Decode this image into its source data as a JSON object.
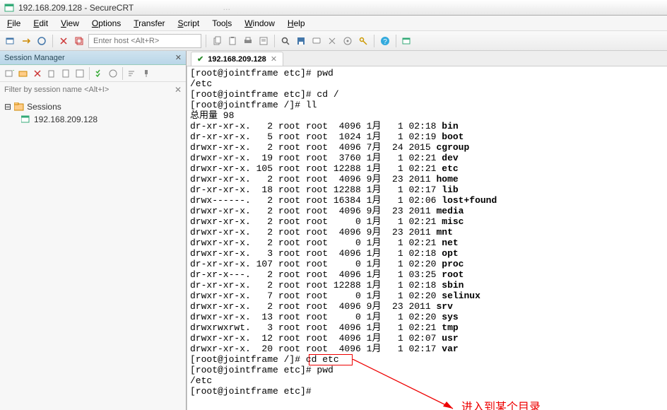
{
  "window": {
    "title": "192.168.209.128 - SecureCRT",
    "blurred_tab": "…"
  },
  "menu": [
    "File",
    "Edit",
    "View",
    "Options",
    "Transfer",
    "Script",
    "Tools",
    "Window",
    "Help"
  ],
  "toolbar": {
    "host_placeholder": "Enter host <Alt+R>"
  },
  "session_manager": {
    "title": "Session Manager",
    "filter_placeholder": "Filter by session name <Alt+I>",
    "root": "Sessions",
    "node": "192.168.209.128"
  },
  "tab": {
    "label": "192.168.209.128"
  },
  "terminal": {
    "lines": [
      {
        "t": "[root@jointframe etc]# pwd"
      },
      {
        "t": "/etc"
      },
      {
        "t": "[root@jointframe etc]# cd /"
      },
      {
        "t": "[root@jointframe /]# ll"
      },
      {
        "t": "总用量 98"
      },
      {
        "t": "dr-xr-xr-x.   2 root root  4096 1月   1 02:18 ",
        "b": "bin"
      },
      {
        "t": "dr-xr-xr-x.   5 root root  1024 1月   1 02:19 ",
        "b": "boot"
      },
      {
        "t": "drwxr-xr-x.   2 root root  4096 7月  24 2015 ",
        "b": "cgroup"
      },
      {
        "t": "drwxr-xr-x.  19 root root  3760 1月   1 02:21 ",
        "b": "dev"
      },
      {
        "t": "drwxr-xr-x. 105 root root 12288 1月   1 02:21 ",
        "b": "etc"
      },
      {
        "t": "drwxr-xr-x.   2 root root  4096 9月  23 2011 ",
        "b": "home"
      },
      {
        "t": "dr-xr-xr-x.  18 root root 12288 1月   1 02:17 ",
        "b": "lib"
      },
      {
        "t": "drwx------.   2 root root 16384 1月   1 02:06 ",
        "b": "lost+found"
      },
      {
        "t": "drwxr-xr-x.   2 root root  4096 9月  23 2011 ",
        "b": "media"
      },
      {
        "t": "drwxr-xr-x.   2 root root     0 1月   1 02:21 ",
        "b": "misc"
      },
      {
        "t": "drwxr-xr-x.   2 root root  4096 9月  23 2011 ",
        "b": "mnt"
      },
      {
        "t": "drwxr-xr-x.   2 root root     0 1月   1 02:21 ",
        "b": "net"
      },
      {
        "t": "drwxr-xr-x.   3 root root  4096 1月   1 02:18 ",
        "b": "opt"
      },
      {
        "t": "dr-xr-xr-x. 107 root root     0 1月   1 02:20 ",
        "b": "proc"
      },
      {
        "t": "dr-xr-x---.   2 root root  4096 1月   1 03:25 ",
        "b": "root"
      },
      {
        "t": "dr-xr-xr-x.   2 root root 12288 1月   1 02:18 ",
        "b": "sbin"
      },
      {
        "t": "drwxr-xr-x.   7 root root     0 1月   1 02:20 ",
        "b": "selinux"
      },
      {
        "t": "drwxr-xr-x.   2 root root  4096 9月  23 2011 ",
        "b": "srv"
      },
      {
        "t": "drwxr-xr-x.  13 root root     0 1月   1 02:20 ",
        "b": "sys"
      },
      {
        "t": "drwxrwxrwt.   3 root root  4096 1月   1 02:21 ",
        "b": "tmp"
      },
      {
        "t": "drwxr-xr-x.  12 root root  4096 1月   1 02:07 ",
        "b": "usr"
      },
      {
        "t": "drwxr-xr-x.  20 root root  4096 1月   1 02:17 ",
        "b": "var"
      },
      {
        "t": "[root@jointframe /]# cd etc"
      },
      {
        "t": "[root@jointframe etc]# pwd"
      },
      {
        "t": "/etc"
      },
      {
        "t": "[root@jointframe etc]#"
      }
    ],
    "annotation": {
      "boxed_cmd": "cd etc",
      "label": "进入到某个目录"
    }
  }
}
